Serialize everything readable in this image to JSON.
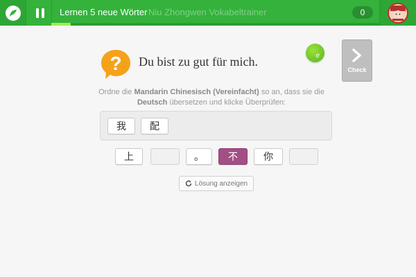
{
  "header": {
    "lesson_title": "Lernen 5 neue Wörter",
    "app_subtitle": "Niu Zhongwen Vokabeltrainer",
    "score": "0",
    "progress": 0.06
  },
  "prompt": {
    "sentence": "Du bist zu gut für mich.",
    "hint_glyph": "e",
    "check_label": "Check"
  },
  "instructions": {
    "part1": "Ordne die ",
    "source_lang": "Mandarin Chinesisch (Vereinfacht)",
    "part2": " so an, dass sie die ",
    "target_lang": "Deutsch",
    "part3": " übersetzen und klicke Überprüfen:"
  },
  "answer_tiles": [
    "我",
    "配"
  ],
  "word_bank": [
    {
      "char": "上",
      "state": "normal"
    },
    {
      "char": "",
      "state": "empty"
    },
    {
      "char": "。",
      "state": "normal"
    },
    {
      "char": "不",
      "state": "selected"
    },
    {
      "char": "你",
      "state": "normal"
    },
    {
      "char": "",
      "state": "empty"
    }
  ],
  "solution_label": "Lösung anzeigen",
  "colors": {
    "header_green": "#34b23c",
    "progress_lime": "#a4ec48",
    "selected_tile": "#a24f85",
    "question_orange": "#f5a21b"
  }
}
